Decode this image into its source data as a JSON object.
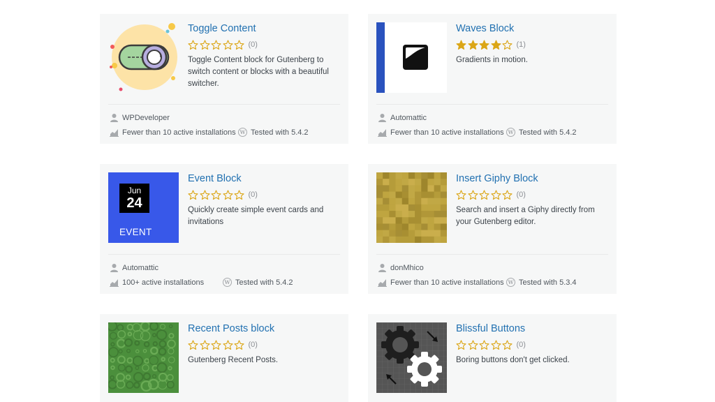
{
  "plugins": [
    {
      "title": "Toggle Content",
      "rating_stars": 0,
      "rating_count": "(0)",
      "description": "Toggle Content block for Gutenberg to switch content or blocks with a beautiful switcher.",
      "author": "WPDeveloper",
      "installs": "Fewer than 10 active installations",
      "tested": "Tested with 5.4.2",
      "thumb_icon": "toggle-switch-illustration"
    },
    {
      "title": "Waves Block",
      "rating_stars": 4,
      "rating_count": "(1)",
      "description": "Gradients in motion.",
      "author": "Automattic",
      "installs": "Fewer than 10 active installations",
      "tested": "Tested with 5.4.2",
      "thumb_icon": "gradient-square-icon"
    },
    {
      "title": "Event Block",
      "rating_stars": 0,
      "rating_count": "(0)",
      "description": "Quickly create simple event cards and invitations",
      "author": "Automattic",
      "installs": "100+ active installations",
      "tested": "Tested with 5.4.2",
      "thumb_month": "Jun",
      "thumb_day": "24",
      "thumb_label": "EVENT"
    },
    {
      "title": "Insert Giphy Block",
      "rating_stars": 0,
      "rating_count": "(0)",
      "description": "Search and insert a Giphy directly from your Gutenberg editor.",
      "author": "donMhico",
      "installs": "Fewer than 10 active installations",
      "tested": "Tested with 5.3.4",
      "thumb_icon": "mosaic-pattern"
    },
    {
      "title": "Recent Posts block",
      "rating_stars": 0,
      "rating_count": "(0)",
      "description": "Gutenberg Recent Posts.",
      "thumb_icon": "green-circles-pattern"
    },
    {
      "title": "Blissful Buttons",
      "rating_stars": 0,
      "rating_count": "(0)",
      "description": "Boring buttons don't get clicked.",
      "thumb_icon": "gears-icon"
    }
  ],
  "colors": {
    "link": "#2271b1",
    "star": "#dba617",
    "card_bg": "#f6f7f7",
    "event_blue": "#3858e9",
    "waves_blue": "#2a52be"
  }
}
